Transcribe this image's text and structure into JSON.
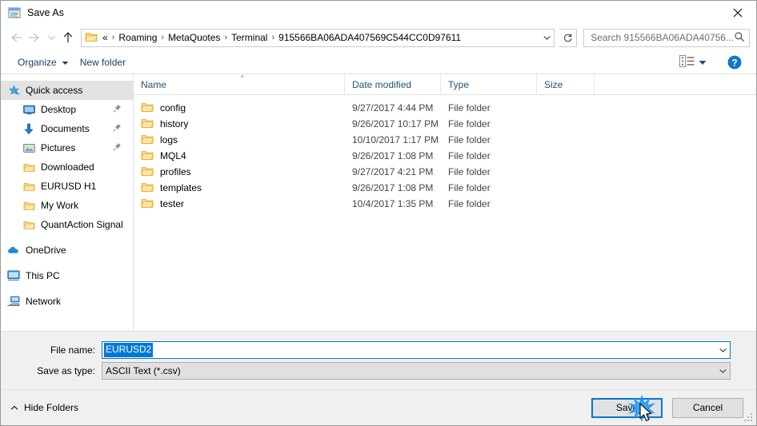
{
  "window": {
    "title": "Save As",
    "icon": "save-as-icon",
    "close_label": "✕"
  },
  "nav": {
    "back": "back-arrow",
    "forward": "forward-arrow",
    "recent": "chevron-down",
    "up": "up-arrow",
    "breadcrumbs": [
      "«",
      "Roaming",
      "MetaQuotes",
      "Terminal",
      "915566BA06ADA407569C544CC0D97611"
    ],
    "separator": "›",
    "dropdown": "chevron-down",
    "refresh": "refresh-icon"
  },
  "search": {
    "placeholder": "Search 915566BA06ADA40756...",
    "icon": "search-icon"
  },
  "toolbar": {
    "organize": "Organize",
    "organize_caret": "▼",
    "new_folder": "New folder",
    "view_icon": "view-options-icon",
    "view_caret": "▼",
    "help": "?"
  },
  "sidebar": {
    "items": [
      {
        "label": "Quick access",
        "icon": "star-pin-icon",
        "selected": true,
        "indent": false,
        "pinned": false
      },
      {
        "label": "Desktop",
        "icon": "desktop-icon",
        "selected": false,
        "indent": true,
        "pinned": true
      },
      {
        "label": "Documents",
        "icon": "documents-arrow-icon",
        "selected": false,
        "indent": true,
        "pinned": true
      },
      {
        "label": "Pictures",
        "icon": "pictures-icon",
        "selected": false,
        "indent": true,
        "pinned": true
      },
      {
        "label": "Downloaded",
        "icon": "folder-icon",
        "selected": false,
        "indent": true,
        "pinned": false
      },
      {
        "label": "EURUSD H1",
        "icon": "folder-icon",
        "selected": false,
        "indent": true,
        "pinned": false
      },
      {
        "label": "My Work",
        "icon": "folder-icon",
        "selected": false,
        "indent": true,
        "pinned": false
      },
      {
        "label": "QuantAction Signal",
        "icon": "folder-icon",
        "selected": false,
        "indent": true,
        "pinned": false
      },
      {
        "label": "OneDrive",
        "icon": "onedrive-cloud-icon",
        "selected": false,
        "indent": false,
        "pinned": false,
        "gap_before": true
      },
      {
        "label": "This PC",
        "icon": "this-pc-icon",
        "selected": false,
        "indent": false,
        "pinned": false,
        "gap_before": true
      },
      {
        "label": "Network",
        "icon": "network-icon",
        "selected": false,
        "indent": false,
        "pinned": false,
        "gap_before": true
      }
    ]
  },
  "filelist": {
    "columns": [
      "Name",
      "Date modified",
      "Type",
      "Size"
    ],
    "sort_column": "Name",
    "sort_caret": "⌃",
    "rows": [
      {
        "name": "config",
        "date": "9/27/2017 4:44 PM",
        "type": "File folder",
        "size": ""
      },
      {
        "name": "history",
        "date": "9/26/2017 10:17 PM",
        "type": "File folder",
        "size": ""
      },
      {
        "name": "logs",
        "date": "10/10/2017 1:17 PM",
        "type": "File folder",
        "size": ""
      },
      {
        "name": "MQL4",
        "date": "9/26/2017 1:08 PM",
        "type": "File folder",
        "size": ""
      },
      {
        "name": "profiles",
        "date": "9/27/2017 4:21 PM",
        "type": "File folder",
        "size": ""
      },
      {
        "name": "templates",
        "date": "9/26/2017 1:08 PM",
        "type": "File folder",
        "size": ""
      },
      {
        "name": "tester",
        "date": "10/4/2017 1:35 PM",
        "type": "File folder",
        "size": ""
      }
    ]
  },
  "form": {
    "filename_label": "File name:",
    "filename_value": "EURUSD2",
    "filename_selected": true,
    "savetype_label": "Save as type:",
    "savetype_value": "ASCII Text (*.csv)",
    "dropdown_caret": "⌄"
  },
  "footer": {
    "hide_folders": "Hide Folders",
    "hide_folders_caret": "⌃",
    "save": "Save",
    "cancel": "Cancel",
    "default_button": "Save"
  },
  "colors": {
    "accent": "#0078d7",
    "folder": "#fcd775",
    "link_text": "#23527c",
    "dialog_bg": "#f0f0f0",
    "selection": "#0078d7"
  }
}
